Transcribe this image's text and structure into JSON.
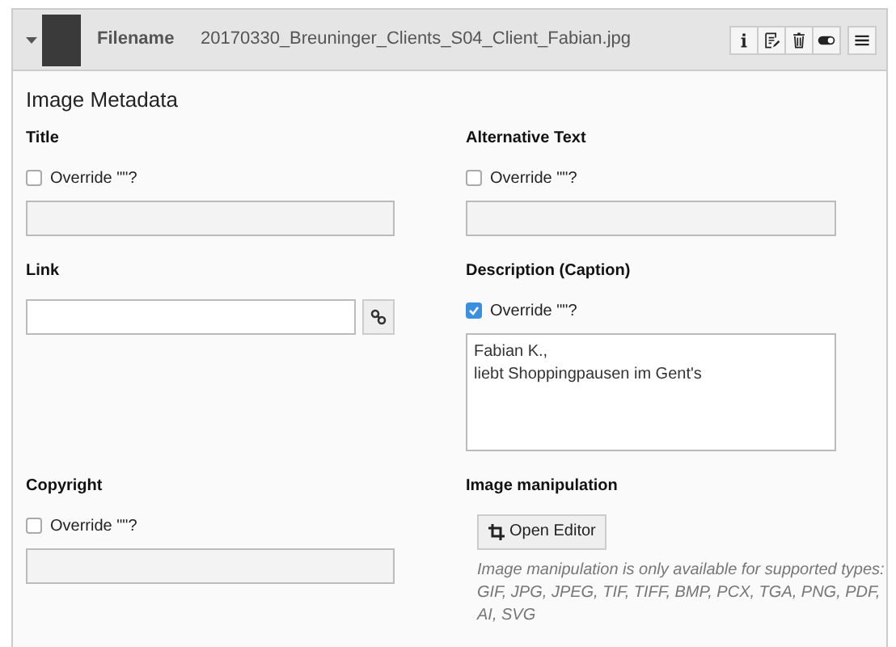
{
  "header": {
    "expanded": true,
    "filename_label": "Filename",
    "filename": "20170330_Breuninger_Clients_S04_Client_Fabian.jpg",
    "actions": [
      {
        "kind": "info"
      },
      {
        "kind": "edit"
      },
      {
        "kind": "delete"
      },
      {
        "kind": "toggle"
      },
      {
        "kind": "menu"
      }
    ]
  },
  "section_title": "Image Metadata",
  "fields": [
    {
      "label": "Title",
      "override": {
        "label": "Override \"\"?",
        "checked": false
      },
      "control": {
        "kind": "input",
        "disabled": true
      }
    },
    {
      "label": "Alternative Text",
      "override": {
        "label": "Override \"\"?",
        "checked": false
      },
      "control": {
        "kind": "input",
        "disabled": true
      }
    },
    {
      "label": "Link",
      "control": {
        "kind": "link-input",
        "disabled": false
      }
    },
    {
      "label": "Description (Caption)",
      "override": {
        "label": "Override \"\"?",
        "checked": true
      },
      "control": {
        "kind": "textarea",
        "disabled": false,
        "value": "Fabian K.,\nliebt Shoppingpausen im Gent's"
      }
    },
    {
      "label": "Copyright",
      "override": {
        "label": "Override \"\"?",
        "checked": false
      },
      "control": {
        "kind": "input",
        "disabled": true
      }
    },
    {
      "label": "Image manipulation",
      "control": {
        "kind": "editor",
        "button": "Open Editor",
        "help": [
          "Image manipulation is only available for supported types:",
          "GIF, JPG, JPEG, TIF, TIFF, BMP, PCX, TGA, PNG, PDF, AI, SVG"
        ]
      }
    }
  ]
}
